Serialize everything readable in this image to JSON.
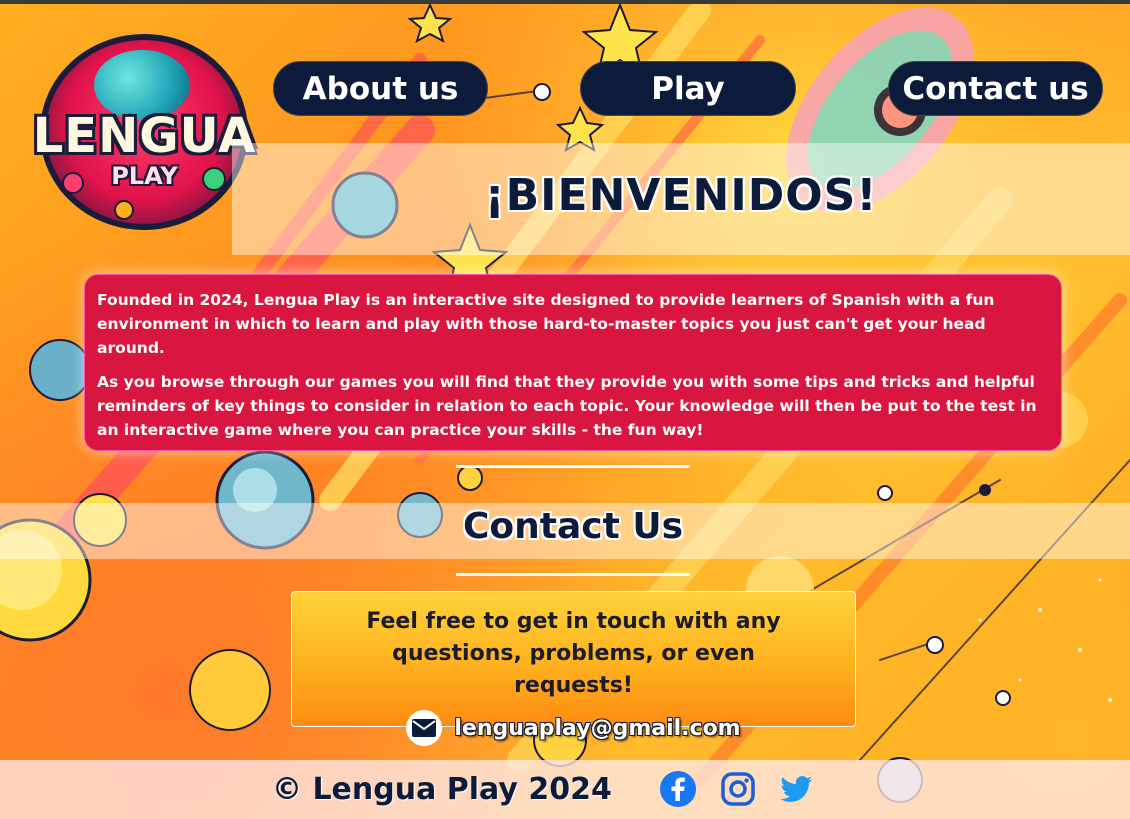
{
  "logo": {
    "word": "LENGUA",
    "sub": "PLAY"
  },
  "nav": {
    "about_label": "About us",
    "play_label": "Play",
    "contact_label": "Contact us"
  },
  "welcome": {
    "title": "¡BIENVENIDOS!"
  },
  "about": {
    "paragraphs": [
      "Founded in 2024, Lengua Play is an interactive site designed to provide learners of Spanish with a fun environment in which to learn and play with those hard-to-master topics you just can't get your head around.",
      "As you browse through our games you will find that they provide you with some tips and tricks and helpful reminders of key things to consider in relation to each topic. Your knowledge will then be put to the test in an interactive game where you can practice your skills - the fun way!"
    ]
  },
  "contact": {
    "title": "Contact Us",
    "text": "Feel free to get in touch with any questions, problems, or even requests!",
    "email": "lenguaplay@gmail.com",
    "email_icon": "envelope-icon"
  },
  "footer": {
    "copyright": "© Lengua Play 2024",
    "social": [
      "facebook-icon",
      "instagram-icon",
      "twitter-icon"
    ]
  },
  "colors": {
    "navy": "#0c1b3a",
    "crimson": "#d9163f",
    "orange": "#f8a31c",
    "facebook": "#1877f2",
    "instagram": "#1a5fd6",
    "twitter": "#1d9bf0"
  }
}
